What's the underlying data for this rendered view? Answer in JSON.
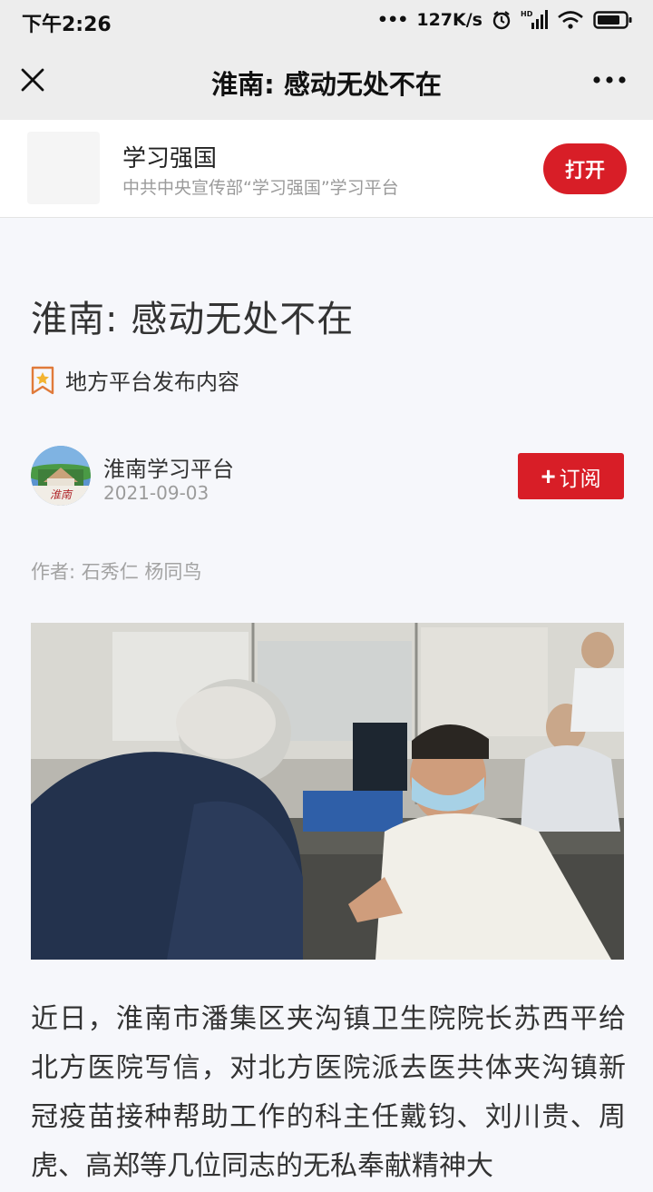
{
  "status_bar": {
    "time": "下午2:26",
    "network_speed": "127K/s",
    "hd_label": "HD"
  },
  "nav": {
    "title": "淮南: 感动无处不在"
  },
  "app_banner": {
    "name": "学习强国",
    "description": "中共中央宣传部“学习强国”学习平台",
    "open_label": "打开"
  },
  "article": {
    "title": "淮南: 感动无处不在",
    "tag_label": "地方平台发布内容",
    "author_name": "淮南学习平台",
    "publish_date": "2021-09-03",
    "subscribe_plus": "+",
    "subscribe_label": "订阅",
    "byline": "作者: 石秀仁 杨同鸟",
    "avatar_text": "淮南",
    "body": "近日，淮南市潘集区夹沟镇卫生院院长苏西平给北方医院写信，对北方医院派去医共体夹沟镇新冠疫苗接种帮助工作的科主任戴钧、刘川贵、周虎、高郑等几位同志的无私奉献精神大"
  },
  "colors": {
    "accent_red": "#d81e27",
    "top_bar_gray": "#ededed",
    "page_bg": "#f6f7fb"
  }
}
